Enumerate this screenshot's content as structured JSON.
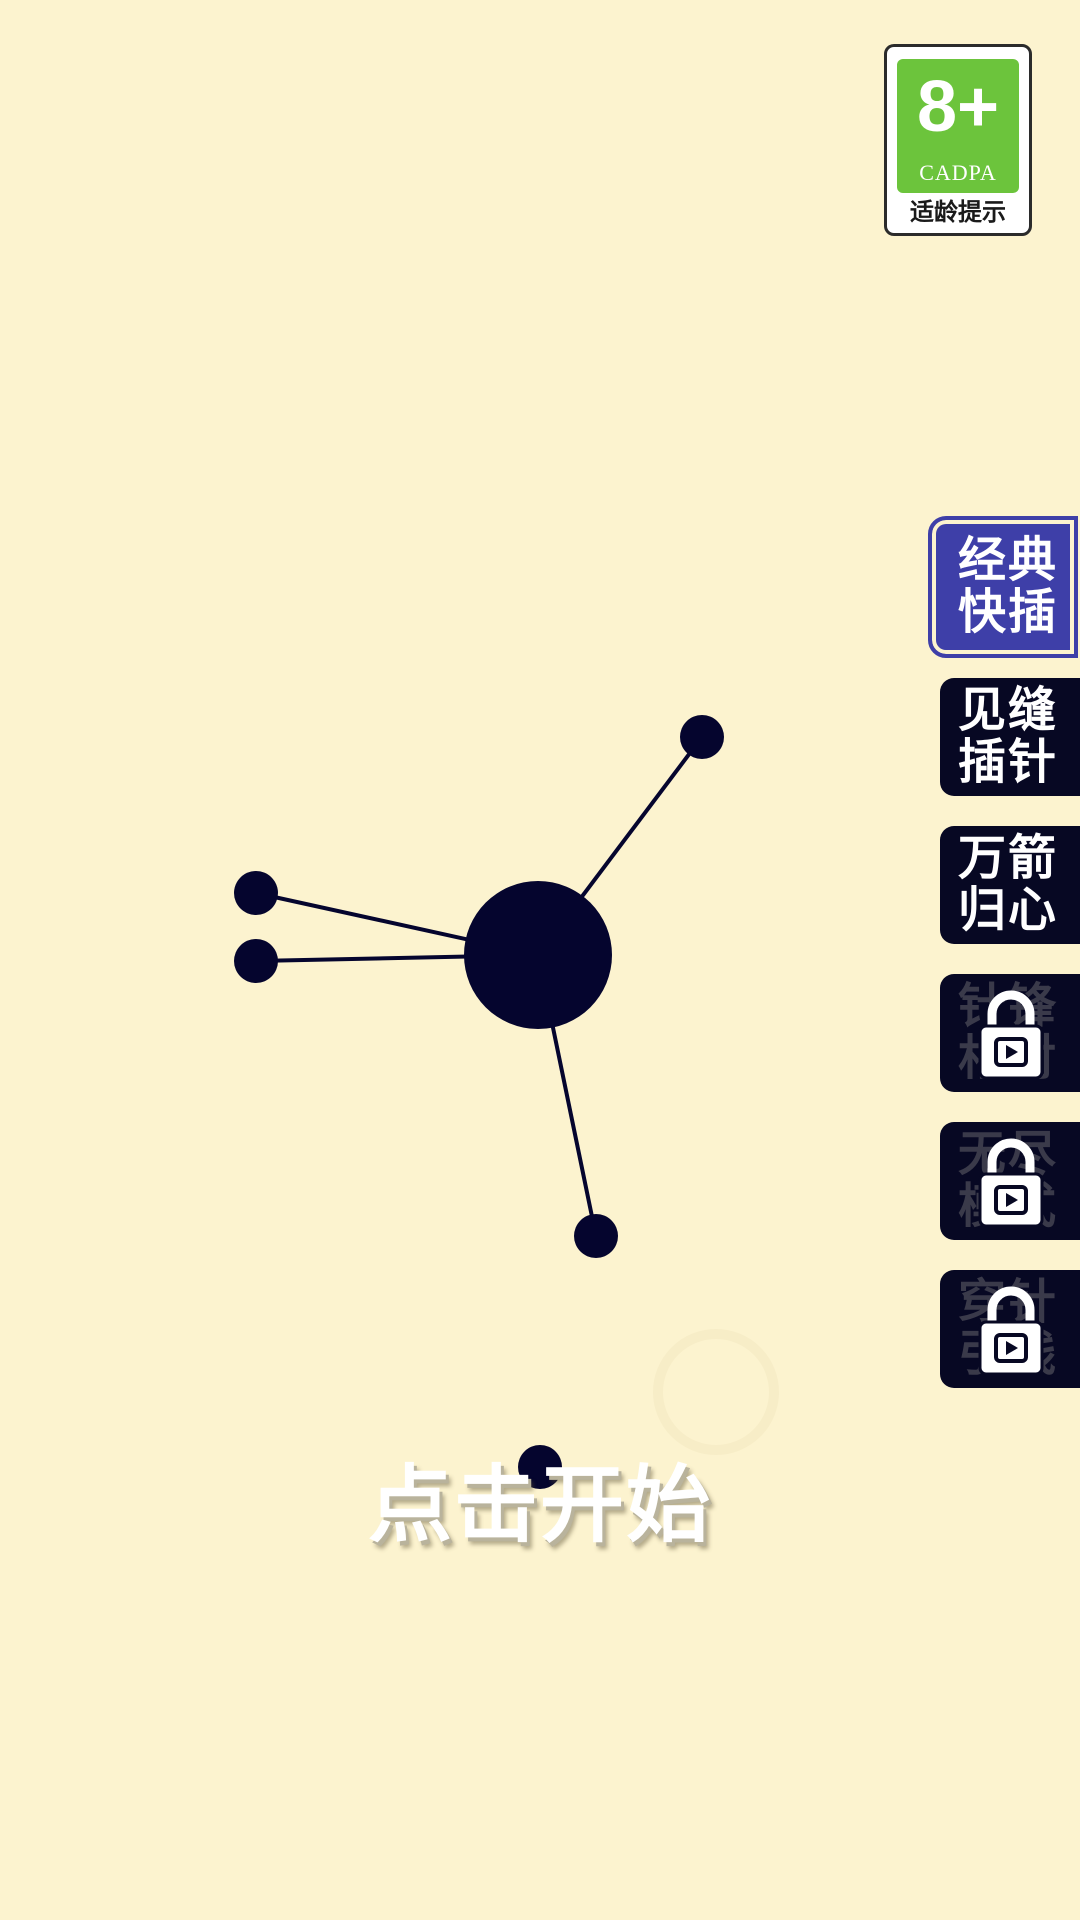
{
  "badge": {
    "age": "8+",
    "org": "CADPA",
    "caption": "适龄提示"
  },
  "start_text": "点击开始",
  "colors": {
    "background": "#FCF3CF",
    "ink": "#05052E",
    "selected_mode": "#3E3FA8",
    "mode_bg": "#070823",
    "badge_green": "#6CC43C"
  },
  "modes": [
    {
      "label": "经典快插",
      "selected": true,
      "locked": false
    },
    {
      "label": "见缝插针",
      "selected": false,
      "locked": false
    },
    {
      "label": "万箭归心",
      "selected": false,
      "locked": false
    },
    {
      "label": "针锋相对",
      "selected": false,
      "locked": true,
      "icon": "lock-video-icon"
    },
    {
      "label": "无尽模式",
      "selected": false,
      "locked": true,
      "icon": "lock-video-icon"
    },
    {
      "label": "穿针引线",
      "selected": false,
      "locked": true,
      "icon": "lock-video-icon"
    }
  ]
}
